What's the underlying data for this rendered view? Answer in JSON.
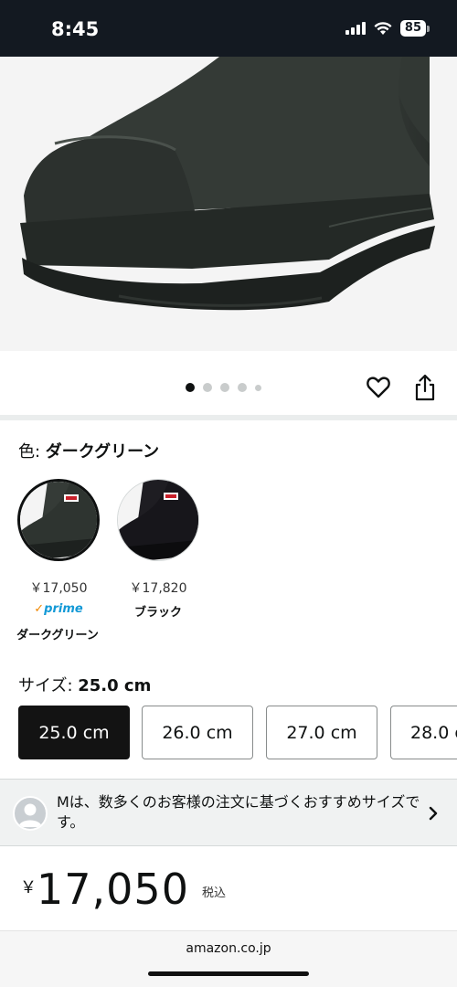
{
  "status": {
    "time": "8:45",
    "battery": "85"
  },
  "gallery": {
    "image_count": 5,
    "active_index": 0
  },
  "color": {
    "label": "色: ",
    "selected": "ダークグリーン",
    "options": [
      {
        "price": "￥17,050",
        "prime": "prime",
        "name": "ダークグリーン",
        "selected": true
      },
      {
        "price": "￥17,820",
        "name": "ブラック",
        "selected": false
      }
    ]
  },
  "size": {
    "label": "サイズ: ",
    "selected": "25.0 cm",
    "options": [
      "25.0 cm",
      "26.0 cm",
      "27.0 cm",
      "28.0 cm"
    ]
  },
  "advisory": {
    "text": "Mは、数多くのお客様の注文に基づくおすすめサイズです。"
  },
  "price": {
    "currency": "￥",
    "amount": "17,050",
    "tax_note": "税込"
  },
  "browser": {
    "url": "amazon.co.jp"
  },
  "colors": {
    "header_bg": "#131921",
    "prime_blue": "#1399d6",
    "selected_chip": "#131313"
  }
}
